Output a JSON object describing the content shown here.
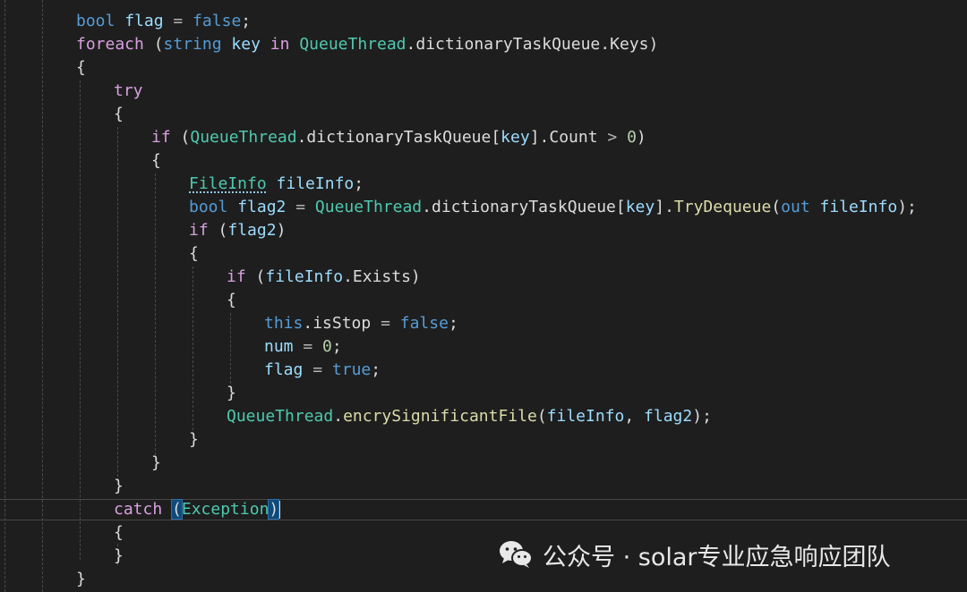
{
  "code": {
    "lines": [
      [
        [
          "kw",
          "bool"
        ],
        [
          "p",
          " "
        ],
        [
          "var",
          "flag"
        ],
        [
          "p",
          " "
        ],
        [
          "op",
          "="
        ],
        [
          "p",
          " "
        ],
        [
          "kw",
          "false"
        ],
        [
          "p",
          ";"
        ]
      ],
      [
        [
          "ctl",
          "foreach"
        ],
        [
          "p",
          " ("
        ],
        [
          "kw",
          "string"
        ],
        [
          "p",
          " "
        ],
        [
          "var",
          "key"
        ],
        [
          "p",
          " "
        ],
        [
          "ctl",
          "in"
        ],
        [
          "p",
          " "
        ],
        [
          "type",
          "QueueThread"
        ],
        [
          "p",
          ".dictionaryTaskQueue.Keys)"
        ]
      ],
      [
        [
          "p",
          "{"
        ]
      ],
      [
        [
          "ctl",
          "try"
        ]
      ],
      [
        [
          "p",
          "{"
        ]
      ],
      [
        [
          "ctl",
          "if"
        ],
        [
          "p",
          " ("
        ],
        [
          "type",
          "QueueThread"
        ],
        [
          "p",
          ".dictionaryTaskQueue["
        ],
        [
          "var",
          "key"
        ],
        [
          "p",
          "].Count "
        ],
        [
          "op",
          ">"
        ],
        [
          "p",
          " "
        ],
        [
          "num",
          "0"
        ],
        [
          "p",
          ")"
        ]
      ],
      [
        [
          "p",
          "{"
        ]
      ],
      [
        [
          "type sq",
          "FileInfo"
        ],
        [
          "p",
          " "
        ],
        [
          "var",
          "fileInfo"
        ],
        [
          "p",
          ";"
        ]
      ],
      [
        [
          "kw",
          "bool"
        ],
        [
          "p",
          " "
        ],
        [
          "var",
          "flag2"
        ],
        [
          "p",
          " "
        ],
        [
          "op",
          "="
        ],
        [
          "p",
          " "
        ],
        [
          "type",
          "QueueThread"
        ],
        [
          "p",
          ".dictionaryTaskQueue["
        ],
        [
          "var",
          "key"
        ],
        [
          "p",
          "]."
        ],
        [
          "meth",
          "TryDequeue"
        ],
        [
          "p",
          "("
        ],
        [
          "kw",
          "out"
        ],
        [
          "p",
          " "
        ],
        [
          "var",
          "fileInfo"
        ],
        [
          "p",
          ");"
        ]
      ],
      [
        [
          "ctl",
          "if"
        ],
        [
          "p",
          " ("
        ],
        [
          "var",
          "flag2"
        ],
        [
          "p",
          ")"
        ]
      ],
      [
        [
          "p",
          "{"
        ]
      ],
      [
        [
          "ctl",
          "if"
        ],
        [
          "p",
          " ("
        ],
        [
          "var",
          "fileInfo"
        ],
        [
          "p",
          ".Exists)"
        ]
      ],
      [
        [
          "p",
          "{"
        ]
      ],
      [
        [
          "kw",
          "this"
        ],
        [
          "p",
          ".isStop "
        ],
        [
          "op",
          "="
        ],
        [
          "p",
          " "
        ],
        [
          "kw",
          "false"
        ],
        [
          "p",
          ";"
        ]
      ],
      [
        [
          "var",
          "num"
        ],
        [
          "p",
          " "
        ],
        [
          "op",
          "="
        ],
        [
          "p",
          " "
        ],
        [
          "num",
          "0"
        ],
        [
          "p",
          ";"
        ]
      ],
      [
        [
          "var",
          "flag"
        ],
        [
          "p",
          " "
        ],
        [
          "op",
          "="
        ],
        [
          "p",
          " "
        ],
        [
          "kw",
          "true"
        ],
        [
          "p",
          ";"
        ]
      ],
      [
        [
          "p",
          "}"
        ]
      ],
      [
        [
          "type",
          "QueueThread"
        ],
        [
          "p",
          "."
        ],
        [
          "meth",
          "encrySignificantFile"
        ],
        [
          "p",
          "("
        ],
        [
          "var",
          "fileInfo"
        ],
        [
          "p",
          ", "
        ],
        [
          "var",
          "flag2"
        ],
        [
          "p",
          ");"
        ]
      ],
      [
        [
          "p",
          "}"
        ]
      ],
      [
        [
          "p",
          "}"
        ]
      ],
      [
        [
          "p",
          "}"
        ]
      ],
      [
        [
          "ctl",
          "catch"
        ],
        [
          "p",
          " "
        ],
        [
          "p bm",
          "("
        ],
        [
          "type",
          "Exception"
        ],
        [
          "p bm",
          ")"
        ]
      ],
      [
        [
          "p",
          "{"
        ]
      ],
      [
        [
          "p",
          "}"
        ]
      ],
      [
        [
          "p",
          "}"
        ]
      ]
    ]
  },
  "watermark": {
    "text": "公众号 · solar专业应急响应团队",
    "icon": "wechat-icon"
  },
  "colors": {
    "background": "#1e1e1e",
    "keyword": "#569cd6",
    "control": "#d8a0df",
    "type": "#4ec9b0",
    "variable": "#9cdcfe",
    "number": "#b5cea8",
    "method": "#dcdcaa"
  }
}
